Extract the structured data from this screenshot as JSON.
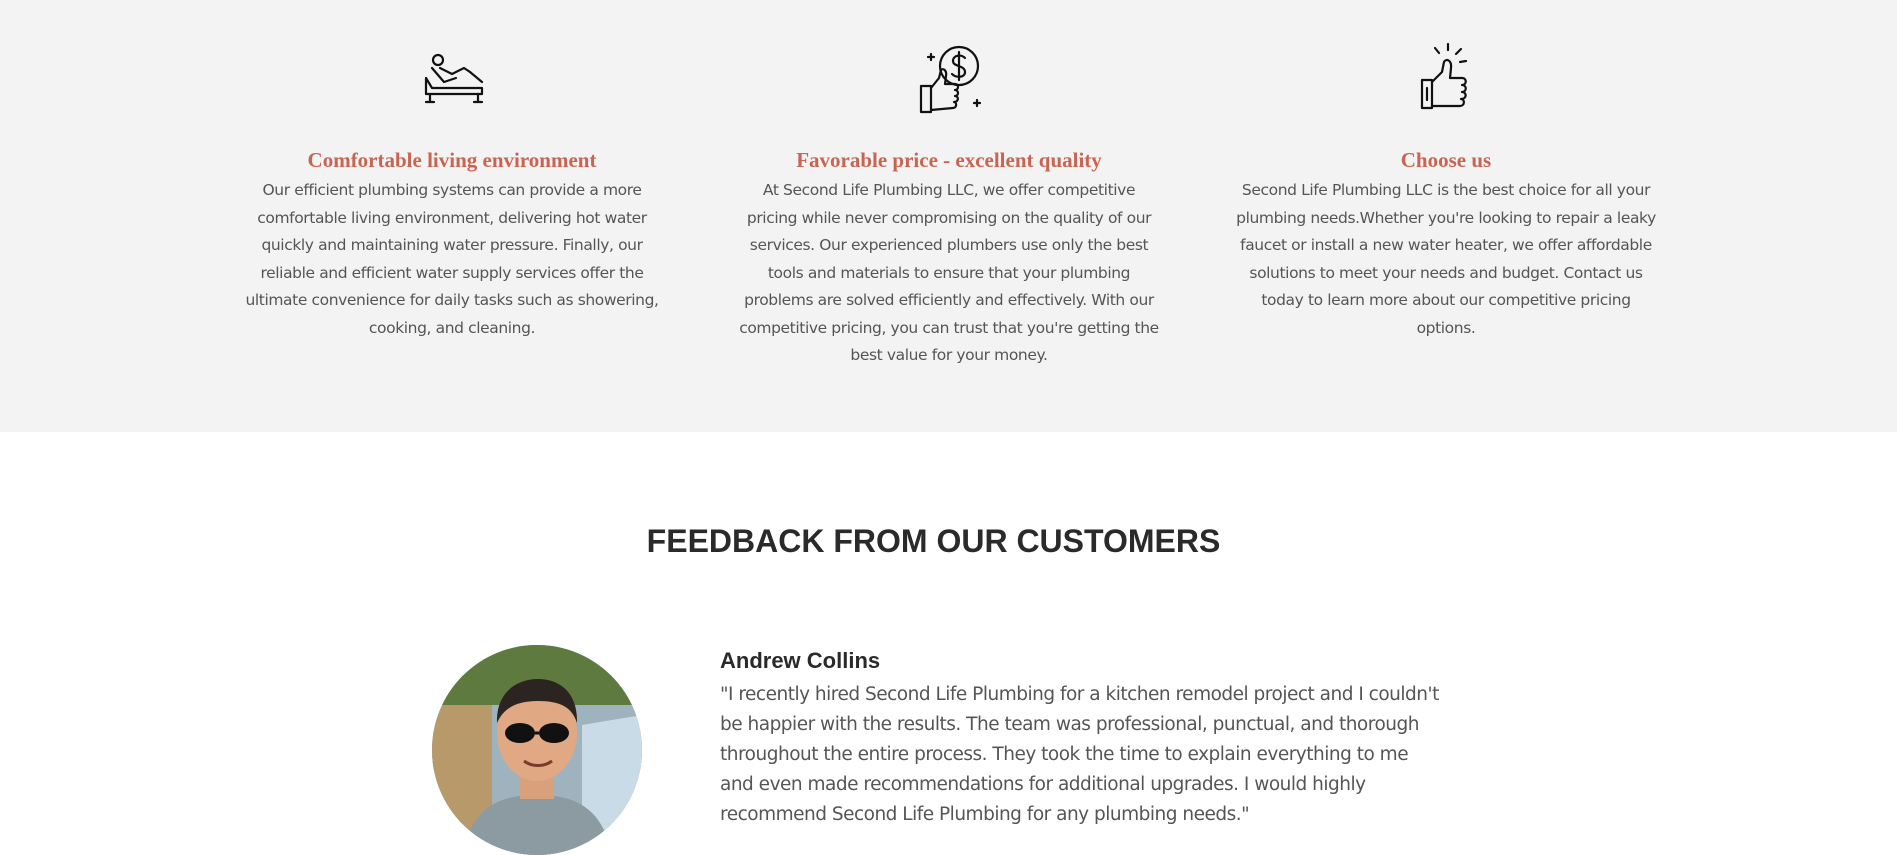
{
  "features": [
    {
      "icon": "lounge-chair-icon",
      "title": "Comfortable living environment",
      "text": "Our efficient plumbing systems can provide a more comfortable living environment, delivering hot water quickly and maintaining water pressure. Finally, our reliable and efficient water supply services offer the ultimate convenience for daily tasks such as showering, cooking, and cleaning."
    },
    {
      "icon": "thumbs-up-dollar-icon",
      "title": "Favorable price - excellent quality",
      "text": "At Second Life Plumbing LLC, we offer competitive pricing while never compromising on the quality of our services. Our experienced plumbers use only the best tools and materials to ensure that your plumbing problems are solved efficiently and effectively. With our competitive pricing, you can trust that you're getting the best value for your money."
    },
    {
      "icon": "thumbs-up-icon",
      "title": "Choose us",
      "text": "Second Life Plumbing LLC is the best choice for all your plumbing needs.Whether you're looking to repair a leaky faucet or install a new water heater, we offer affordable solutions to meet your needs and budget. Contact us today to learn more about our competitive pricing options."
    }
  ],
  "feedback": {
    "title": "FEEDBACK FROM OUR CUSTOMERS",
    "review": {
      "name": "Andrew Collins",
      "text": "\"I recently hired Second Life Plumbing for a kitchen remodel project and I couldn't be happier with the results. The team was professional, punctual, and thorough throughout the entire process. They took the time to explain everything to me and even made recommendations for additional upgrades. I would highly recommend Second Life Plumbing for any plumbing needs.\""
    }
  },
  "colors": {
    "feature_title": "#c86552",
    "features_bg": "#f3f3f3",
    "heading": "#2a2a2a",
    "body_text": "#555555"
  }
}
